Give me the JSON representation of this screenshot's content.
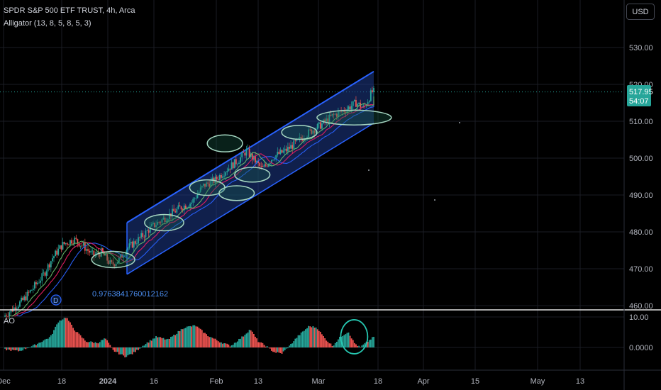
{
  "header": {
    "title": "SPDR S&P 500 ETF TRUST, 4h, Arca",
    "indicator": "Alligator (13, 8, 5, 8, 5, 3)",
    "currency_button": "USD"
  },
  "colors": {
    "bull": "#26a69a",
    "bear": "#ef5350",
    "channel_line": "#2962ff",
    "channel_fill": "#1e3a8a",
    "jaw": "#2962ff",
    "teeth": "#e91e63",
    "lips": "#66bb6a",
    "ellipse": "#a5d6c1",
    "price_badge": "#26a69a"
  },
  "price_badge": {
    "price": "517.95",
    "countdown": "54:07"
  },
  "annotation": "0.9763841760012162",
  "marker": "D",
  "chart_data": [
    {
      "type": "candlestick",
      "title": "",
      "timeframe": "4h",
      "x_ticks": [
        "Dec",
        "18",
        "2024",
        "16",
        "Feb",
        "13",
        "Mar",
        "18",
        "Apr",
        "15",
        "May",
        "13"
      ],
      "y_ticks": [
        460,
        470,
        480,
        490,
        500,
        510,
        520,
        530
      ],
      "ylim": [
        459,
        537
      ],
      "last_price": 517.95,
      "ohlc_summary": [
        {
          "x": 0.0,
          "close": 457.0
        },
        {
          "x": 1.0,
          "close": 461.5
        },
        {
          "x": 2.0,
          "close": 468.0
        },
        {
          "x": 2.5,
          "close": 473.0
        },
        {
          "x": 3.0,
          "close": 476.5
        },
        {
          "x": 3.6,
          "close": 478.0
        },
        {
          "x": 4.1,
          "close": 476.0
        },
        {
          "x": 4.6,
          "close": 473.5
        },
        {
          "x": 5.0,
          "close": 474.5
        },
        {
          "x": 5.5,
          "close": 471.0
        },
        {
          "x": 5.9,
          "close": 472.5
        },
        {
          "x": 6.3,
          "close": 475.5
        },
        {
          "x": 6.9,
          "close": 478.0
        },
        {
          "x": 7.6,
          "close": 481.5
        },
        {
          "x": 8.3,
          "close": 484.0
        },
        {
          "x": 9.0,
          "close": 486.5
        },
        {
          "x": 9.6,
          "close": 488.0
        },
        {
          "x": 10.2,
          "close": 492.5
        },
        {
          "x": 10.8,
          "close": 494.0
        },
        {
          "x": 11.4,
          "close": 497.0
        },
        {
          "x": 12.0,
          "close": 499.5
        },
        {
          "x": 12.4,
          "close": 502.0
        },
        {
          "x": 12.8,
          "close": 499.5
        },
        {
          "x": 13.2,
          "close": 497.0
        },
        {
          "x": 13.8,
          "close": 500.5
        },
        {
          "x": 14.4,
          "close": 502.0
        },
        {
          "x": 15.0,
          "close": 504.5
        },
        {
          "x": 15.6,
          "close": 507.0
        },
        {
          "x": 16.2,
          "close": 509.0
        },
        {
          "x": 16.8,
          "close": 511.5
        },
        {
          "x": 17.4,
          "close": 513.0
        },
        {
          "x": 18.0,
          "close": 515.0
        },
        {
          "x": 18.4,
          "close": 513.5
        },
        {
          "x": 18.8,
          "close": 517.95
        }
      ],
      "channel": {
        "upper": [
          [
            6.3,
            482.5
          ],
          [
            18.9,
            523.5
          ]
        ],
        "lower": [
          [
            6.3,
            468.5
          ],
          [
            18.9,
            509.5
          ]
        ]
      }
    },
    {
      "type": "bar",
      "title": "",
      "indicator": "AO",
      "y_ticks": [
        0.0,
        10.0
      ],
      "y_tick_labels": [
        "0.0000",
        "10.00"
      ],
      "ylim": [
        -6,
        12
      ],
      "values_summary": [
        [
          0.0,
          -0.6
        ],
        [
          0.8,
          -1.2
        ],
        [
          1.6,
          0.8
        ],
        [
          2.4,
          3.5
        ],
        [
          2.8,
          8.5
        ],
        [
          3.2,
          10.0
        ],
        [
          3.6,
          6.0
        ],
        [
          4.2,
          2.0
        ],
        [
          4.8,
          1.5
        ],
        [
          5.2,
          3.0
        ],
        [
          5.6,
          -1.0
        ],
        [
          6.2,
          -3.0
        ],
        [
          6.6,
          -2.0
        ],
        [
          7.2,
          1.0
        ],
        [
          7.8,
          3.5
        ],
        [
          8.4,
          2.5
        ],
        [
          8.8,
          4.5
        ],
        [
          9.2,
          6.5
        ],
        [
          9.8,
          7.2
        ],
        [
          10.4,
          4.0
        ],
        [
          11.0,
          2.0
        ],
        [
          11.6,
          0.5
        ],
        [
          12.2,
          3.5
        ],
        [
          12.6,
          6.0
        ],
        [
          13.0,
          2.0
        ],
        [
          13.4,
          0.5
        ],
        [
          13.8,
          -1.5
        ],
        [
          14.2,
          -2.0
        ],
        [
          14.6,
          0.5
        ],
        [
          15.0,
          3.5
        ],
        [
          15.6,
          7.0
        ],
        [
          16.0,
          6.5
        ],
        [
          16.4,
          3.0
        ],
        [
          16.8,
          0.5
        ],
        [
          17.2,
          3.5
        ],
        [
          17.6,
          5.2
        ],
        [
          17.9,
          1.5
        ],
        [
          18.2,
          0.0
        ],
        [
          18.5,
          1.5
        ],
        [
          18.9,
          3.5
        ]
      ]
    }
  ]
}
